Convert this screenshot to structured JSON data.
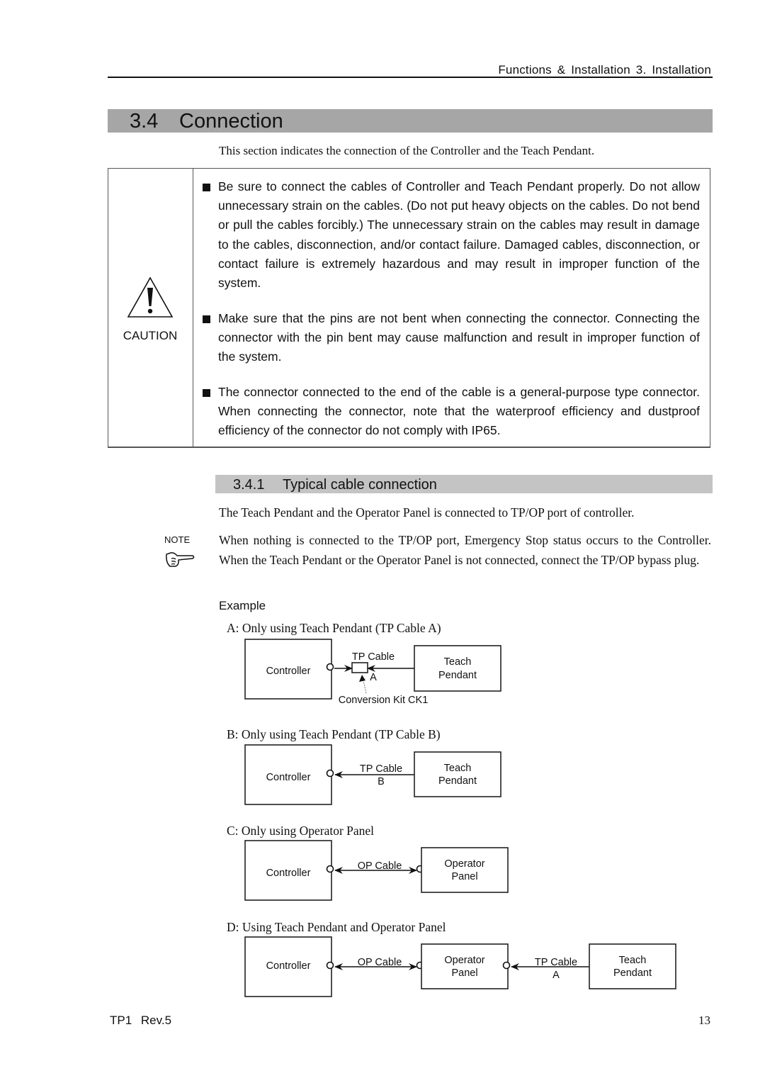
{
  "header": {
    "running_title": "Functions & Installation   3. Installation"
  },
  "section": {
    "number": "3.4",
    "title": "Connection",
    "intro": "This section indicates the connection of the Controller and the Teach Pendant."
  },
  "caution": {
    "icon": "warning-triangle-icon",
    "label": "CAUTION",
    "bullets": [
      "Be sure to connect the cables of Controller and Teach Pendant properly.  Do not allow unnecessary strain on the cables. (Do not put heavy objects on the cables. Do not bend or pull the cables forcibly.)  The unnecessary strain on the cables may result in damage to the cables, disconnection, and/or contact failure. Damaged cables, disconnection, or contact failure is extremely hazardous and may result in improper function of the system.",
      "Make sure that the pins are not bent when connecting the connector. Connecting the connector with the pin bent may cause malfunction and result in improper function of the system.",
      "The connector connected to the end of the cable is a general-purpose type connector.  When connecting the connector, note that the waterproof efficiency and dustproof efficiency of the connector do not comply with IP65."
    ]
  },
  "subsection": {
    "number": "3.4.1",
    "title": "Typical cable connection",
    "text": "The Teach Pendant and the Operator Panel is connected to TP/OP port of controller.",
    "note": {
      "label": "NOTE",
      "icon": "pointing-hand-icon",
      "text": "When nothing is connected to the TP/OP port, Emergency Stop status occurs to the Controller.  When the Teach Pendant or the Operator Panel is not connected, connect the TP/OP bypass plug."
    },
    "example_label": "Example"
  },
  "diagrams": {
    "a": {
      "caption": "A: Only using Teach Pendant (TP Cable A)",
      "controller": "Controller",
      "cable": "TP Cable",
      "cable_suffix": "A",
      "kit": "Conversion Kit CK1",
      "device_line1": "Teach",
      "device_line2": "Pendant"
    },
    "b": {
      "caption": "B: Only using Teach Pendant (TP Cable B)",
      "controller": "Controller",
      "cable": "TP Cable",
      "cable_suffix": "B",
      "device_line1": "Teach",
      "device_line2": "Pendant"
    },
    "c": {
      "caption": "C: Only using Operator Panel",
      "controller": "Controller",
      "cable": "OP Cable",
      "device_line1": "Operator",
      "device_line2": "Panel"
    },
    "d": {
      "caption": "D: Using Teach Pendant and Operator Panel",
      "controller": "Controller",
      "cable1": "OP Cable",
      "panel_line1": "Operator",
      "panel_line2": "Panel",
      "cable2": "TP Cable",
      "cable2_suffix": "A",
      "device_line1": "Teach",
      "device_line2": "Pendant"
    }
  },
  "footer": {
    "doc_id": "TP1   Rev.5",
    "page_number": "13"
  }
}
